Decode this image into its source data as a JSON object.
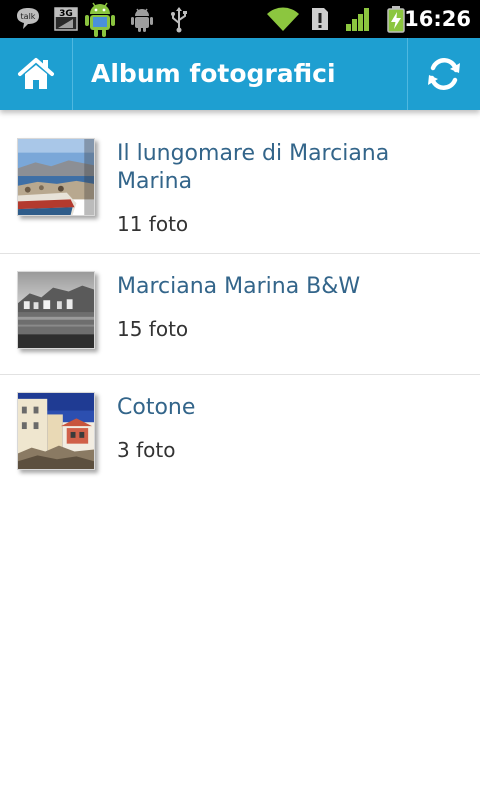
{
  "status_bar": {
    "time": "16:26",
    "icons": [
      "talk-icon",
      "3g-icon",
      "android-market-icon",
      "android-debug-icon",
      "usb-icon",
      "wifi-icon",
      "sd-warning-icon",
      "signal-icon",
      "battery-charging-icon"
    ],
    "talk_label": "talk",
    "network_label": "3G"
  },
  "action_bar": {
    "title": "Album fotografici",
    "home_icon": "home-icon",
    "refresh_icon": "refresh-icon",
    "background": "#1e9fd1"
  },
  "albums": [
    {
      "title": "Il lungomare di Marciana Marina",
      "count": "11 foto",
      "thumbnail": "seaside-boats-photo"
    },
    {
      "title": "Marciana Marina B&W",
      "count": "15 foto",
      "thumbnail": "harbor-bw-photo"
    },
    {
      "title": "Cotone",
      "count": "3 foto",
      "thumbnail": "coastal-houses-photo"
    }
  ],
  "colors": {
    "title_text": "#33658a",
    "count_text": "#333333",
    "divider": "#e2e2e2"
  }
}
